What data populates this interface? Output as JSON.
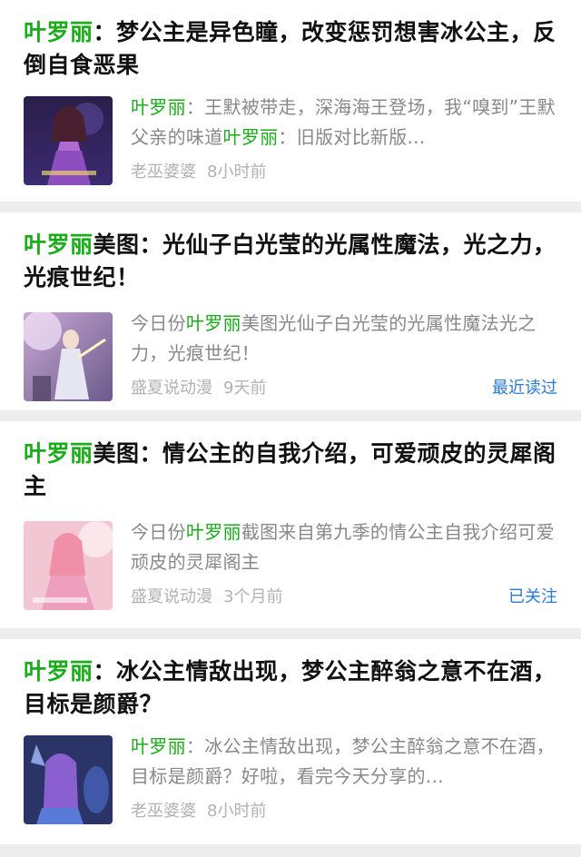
{
  "articles": [
    {
      "title_parts": [
        "叶罗丽",
        "：梦公主是异色瞳，改变惩罚想害冰公主，反倒自食恶果"
      ],
      "snippet_parts": [
        "叶罗丽",
        "：王默被带走，深海海王登场，我“嗅到”王默父亲的味道",
        "叶罗丽",
        "：旧版对比新版..."
      ],
      "source": "老巫婆婆",
      "time": "8小时前",
      "tag": ""
    },
    {
      "title_parts": [
        "叶罗丽",
        "美图：光仙子白光莹的光属性魔法，光之力，光痕世纪！"
      ],
      "snippet_parts": [
        "今日份",
        "叶罗丽",
        "美图光仙子白光莹的光属性魔法光之力，光痕世纪！"
      ],
      "source": "盛夏说动漫",
      "time": "9天前",
      "tag": "最近读过"
    },
    {
      "title_parts": [
        "叶罗丽",
        "美图：情公主的自我介绍，可爱顽皮的灵犀阁主"
      ],
      "snippet_parts": [
        "今日份",
        "叶罗丽",
        "截图来自第九季的情公主自我介绍可爱顽皮的灵犀阁主"
      ],
      "source": "盛夏说动漫",
      "time": "3个月前",
      "tag": "已关注"
    },
    {
      "title_parts": [
        "叶罗丽",
        "：冰公主情敌出现，梦公主醉翁之意不在酒，目标是颜爵？"
      ],
      "snippet_parts": [
        "叶罗丽",
        "：冰公主情敌出现，梦公主醉翁之意不在酒，目标是颜爵？好啦，看完今天分享的..."
      ],
      "source": "老巫婆婆",
      "time": "8小时前",
      "tag": ""
    }
  ],
  "colors": {
    "highlight": "#1aad19",
    "tag": "#2a7ad5",
    "meta": "#b2b2b2"
  }
}
